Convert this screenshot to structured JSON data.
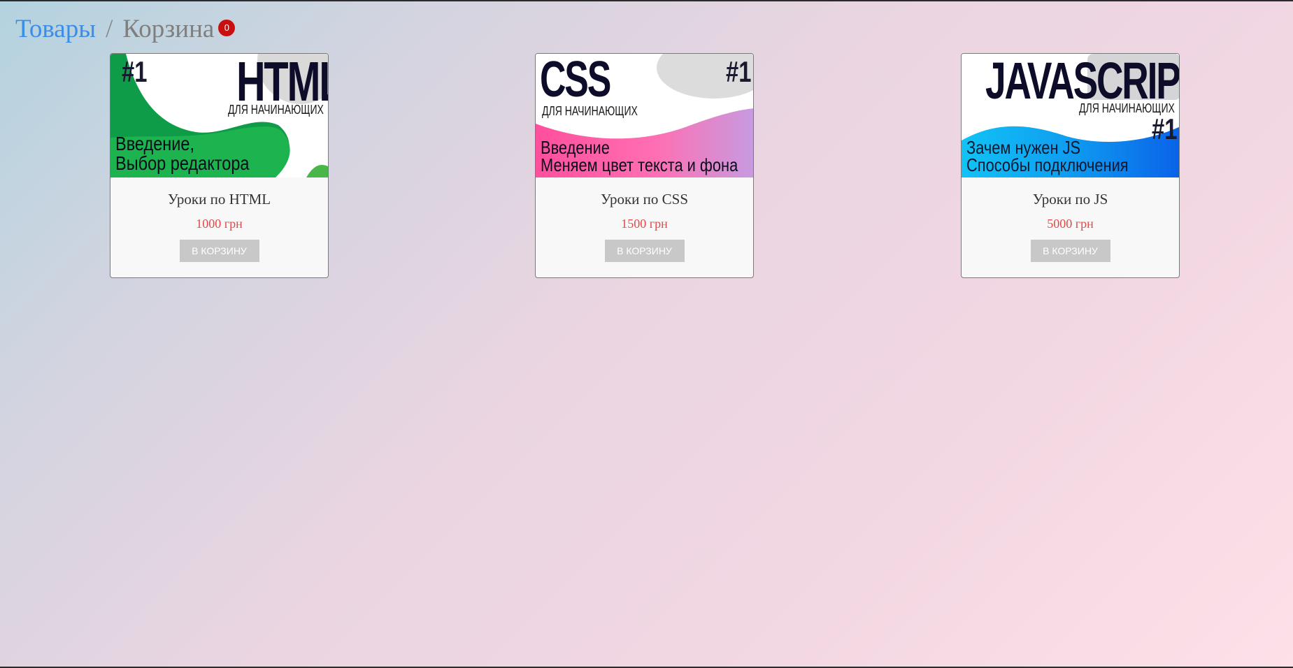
{
  "breadcrumb": {
    "products_label": "Товары",
    "separator": "/",
    "cart_label": "Корзина",
    "cart_count": "0"
  },
  "colors": {
    "link": "#3b8ee8",
    "badge": "#c91010",
    "price": "#e14848",
    "button": "#c8c8c8"
  },
  "products": [
    {
      "title": "Уроки по HTML",
      "price": "1000 грн",
      "button_label": "В КОРЗИНУ",
      "cover": {
        "number": "#1",
        "heading": "HTML",
        "subtitle": "ДЛЯ НАЧИНАЮЩИХ",
        "caption_line1": "Введение,",
        "caption_line2": "Выбор редактора"
      }
    },
    {
      "title": "Уроки по CSS",
      "price": "1500 грн",
      "button_label": "В КОРЗИНУ",
      "cover": {
        "number": "#1",
        "heading": "CSS",
        "subtitle": "ДЛЯ НАЧИНАЮЩИХ",
        "caption_line1": "Введение",
        "caption_line2": "Меняем цвет текста и фона"
      }
    },
    {
      "title": "Уроки по JS",
      "price": "5000 грн",
      "button_label": "В КОРЗИНУ",
      "cover": {
        "number": "#1",
        "heading": "JAVASCRIPT",
        "subtitle": "ДЛЯ НАЧИНАЮЩИХ",
        "caption_line1": "Зачем нужен JS",
        "caption_line2": "Способы подключения"
      }
    }
  ]
}
